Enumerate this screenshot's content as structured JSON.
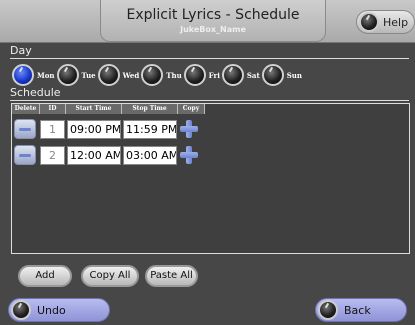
{
  "header": {
    "title": "Explicit Lyrics - Schedule",
    "subtitle": "JukeBox_Name",
    "help_label": "Help"
  },
  "day_section": {
    "label": "Day",
    "days": [
      {
        "label": "Mon",
        "selected": true
      },
      {
        "label": "Tue",
        "selected": false
      },
      {
        "label": "Wed",
        "selected": false
      },
      {
        "label": "Thu",
        "selected": false
      },
      {
        "label": "Fri",
        "selected": false
      },
      {
        "label": "Sat",
        "selected": false
      },
      {
        "label": "Sun",
        "selected": false
      }
    ]
  },
  "schedule_section": {
    "label": "Schedule",
    "columns": [
      "Delete",
      "ID",
      "Start Time",
      "Stop Time",
      "Copy"
    ],
    "rows": [
      {
        "id": "1",
        "start": "09:00 PM",
        "stop": "11:59 PM"
      },
      {
        "id": "2",
        "start": "12:00 AM",
        "stop": "03:00 AM"
      }
    ]
  },
  "actions": {
    "add_label": "Add",
    "copy_all_label": "Copy All",
    "paste_all_label": "Paste All"
  },
  "footer": {
    "undo_label": "Undo",
    "back_label": "Back"
  },
  "colors": {
    "selected_day": "#1838c8",
    "accent_blue": "#6d83d0",
    "nav_button": "#a3a7e3"
  },
  "icons": {
    "delete": "minus-icon",
    "copy": "plus-icon",
    "knob": "knob-icon"
  }
}
